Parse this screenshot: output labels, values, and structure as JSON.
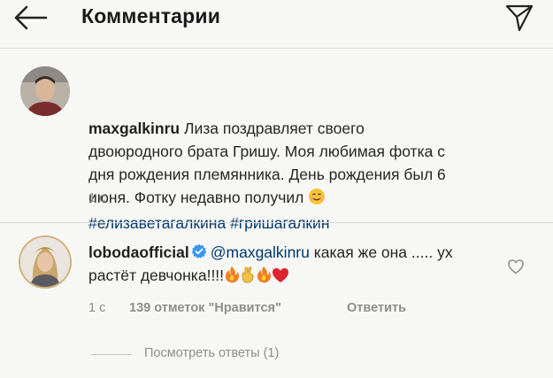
{
  "header": {
    "title": "Комментарии"
  },
  "caption": {
    "username": "maxgalkinru",
    "text": " Лиза поздравляет своего двоюродного брата Гришу. Моя любимая фотка с дня рождения племянника. День рождения был 6 июня. Фотку недавно получил ",
    "hashtags": "#елизаветагалкина #гришагалкин",
    "time": "1 с"
  },
  "comment": {
    "username": "lobodaofficial",
    "mention": "@maxgalkinru",
    "text": " какая же она ..... ух растёт девчонка!!!!",
    "time": "1 с",
    "likes": "139 отметок \"Нравится\"",
    "reply_label": "Ответить"
  },
  "replies": {
    "label": "Посмотреть ответы (1)"
  },
  "icons": {
    "back": "arrow-left-icon",
    "send": "paper-plane-icon",
    "verified": "verified-badge-icon",
    "heart": "heart-outline-icon"
  },
  "colors": {
    "link": "#00376b",
    "verified": "#3897f0",
    "meta": "#8e8e8e"
  }
}
